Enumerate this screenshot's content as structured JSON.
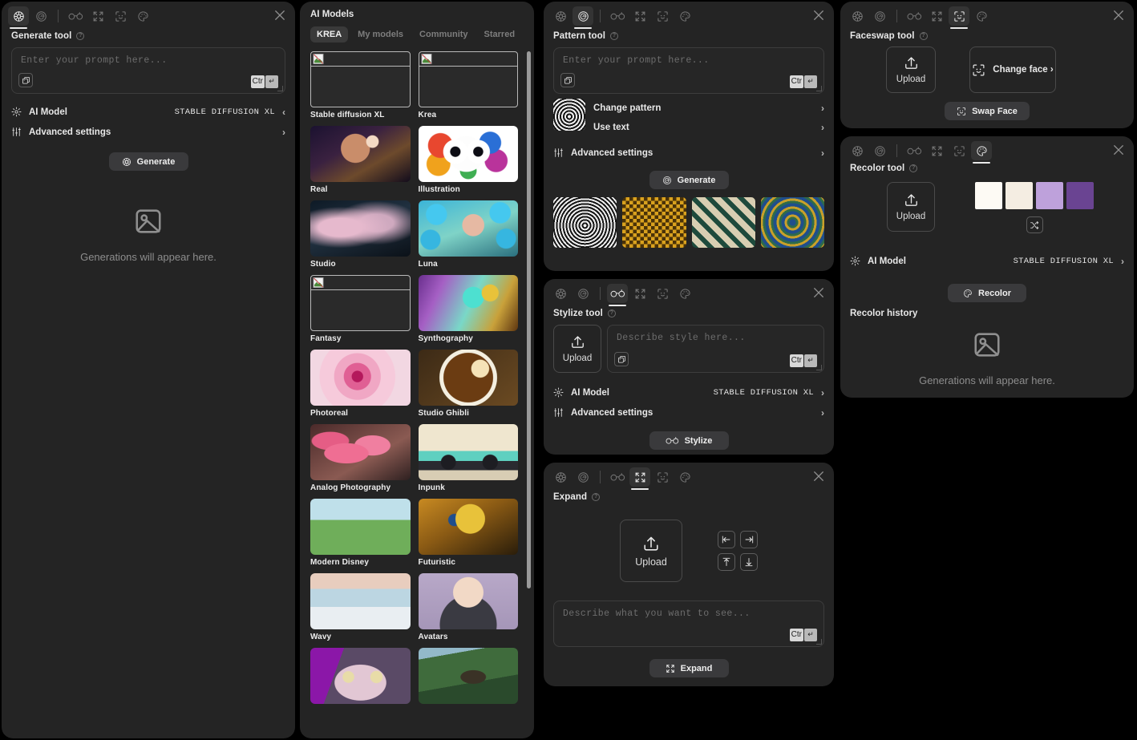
{
  "toolbar": {
    "tabs": [
      {
        "name": "generate",
        "icon": "aperture-icon"
      },
      {
        "name": "pattern",
        "icon": "spiral-icon"
      },
      {
        "name": "stylize",
        "icon": "glasses-icon"
      },
      {
        "name": "expand",
        "icon": "expand-arrows-icon"
      },
      {
        "name": "faceswap",
        "icon": "face-icon"
      },
      {
        "name": "recolor",
        "icon": "palette-icon"
      }
    ],
    "close_icon": "close-icon"
  },
  "kbd": {
    "ctrl": "Ctr",
    "enter": "↵"
  },
  "generate_panel": {
    "title": "Generate tool",
    "prompt_placeholder": "Enter your prompt here...",
    "ai_model_label": "AI Model",
    "ai_model_value": "STABLE DIFFUSION XL",
    "ai_model_chevron": "‹",
    "advanced_label": "Advanced settings",
    "advanced_chevron": "›",
    "button_label": "Generate",
    "empty_text": "Generations will appear here."
  },
  "models_panel": {
    "title": "AI Models",
    "tabs": [
      {
        "label": "KREA",
        "active": true
      },
      {
        "label": "My models",
        "active": false
      },
      {
        "label": "Community",
        "active": false
      },
      {
        "label": "Starred",
        "active": false
      }
    ],
    "models": [
      {
        "name": "Stable diffusion XL",
        "broken": true,
        "thumb": "none"
      },
      {
        "name": "Krea",
        "broken": true,
        "thumb": "none"
      },
      {
        "name": "Real",
        "broken": false,
        "thumb": "portrait-glitter"
      },
      {
        "name": "Illustration",
        "broken": false,
        "thumb": "colorful-skull"
      },
      {
        "name": "Studio",
        "broken": false,
        "thumb": "car-smoke"
      },
      {
        "name": "Luna",
        "broken": false,
        "thumb": "blue-flowers-woman"
      },
      {
        "name": "Fantasy",
        "broken": true,
        "thumb": "none"
      },
      {
        "name": "Synthography",
        "broken": false,
        "thumb": "iridescent-insect"
      },
      {
        "name": "Photoreal",
        "broken": false,
        "thumb": "pink-rose"
      },
      {
        "name": "Studio Ghibli",
        "broken": false,
        "thumb": "ramen-bowl"
      },
      {
        "name": "Analog Photography",
        "broken": false,
        "thumb": "pink-leaves"
      },
      {
        "name": "Inpunk",
        "broken": false,
        "thumb": "teal-sportscar"
      },
      {
        "name": "Modern Disney",
        "broken": false,
        "thumb": "pink-castle"
      },
      {
        "name": "Futuristic",
        "broken": false,
        "thumb": "gold-robot-head"
      },
      {
        "name": "Wavy",
        "broken": false,
        "thumb": "snow-cabin"
      },
      {
        "name": "Avatars",
        "broken": false,
        "thumb": "3d-avatar"
      },
      {
        "name": "",
        "broken": false,
        "thumb": "purple-hair-eyes"
      },
      {
        "name": "",
        "broken": false,
        "thumb": "green-pagoda"
      }
    ]
  },
  "pattern_panel": {
    "title": "Pattern tool",
    "prompt_placeholder": "Enter your prompt here...",
    "change_pattern_label": "Change pattern",
    "use_text_label": "Use text",
    "advanced_label": "Advanced settings",
    "chevron": "›",
    "button_label": "Generate",
    "thumbnails": [
      "heart-op-art",
      "gold-checkerboard",
      "green-diamond-tile",
      "blue-gold-spiral"
    ]
  },
  "stylize_panel": {
    "title": "Stylize tool",
    "upload_label": "Upload",
    "prompt_placeholder": "Describe style here...",
    "ai_model_label": "AI Model",
    "ai_model_value": "STABLE DIFFUSION XL",
    "advanced_label": "Advanced settings",
    "chevron": "›",
    "button_label": "Stylize"
  },
  "expand_panel": {
    "title": "Expand",
    "upload_label": "Upload",
    "prompt_placeholder": "Describe what you want to see...",
    "directions": [
      {
        "name": "expand-left",
        "icon": "arrow-left-to-bar-icon"
      },
      {
        "name": "expand-right",
        "icon": "arrow-right-to-bar-icon"
      },
      {
        "name": "expand-up",
        "icon": "arrow-up-from-bar-icon"
      },
      {
        "name": "expand-down",
        "icon": "arrow-down-to-bar-icon"
      }
    ],
    "button_label": "Expand"
  },
  "faceswap_panel": {
    "title": "Faceswap tool",
    "upload_label": "Upload",
    "change_face_label": "Change face ›",
    "button_label": "Swap Face"
  },
  "recolor_panel": {
    "title": "Recolor tool",
    "upload_label": "Upload",
    "swatches": [
      "#FDFAF4",
      "#F4EDE2",
      "#BEA1DB",
      "#6A4492"
    ],
    "shuffle_icon": "shuffle-icon",
    "ai_model_label": "AI Model",
    "ai_model_value": "STABLE DIFFUSION XL",
    "chevron": "›",
    "button_label": "Recolor",
    "history_label": "Recolor history",
    "empty_text": "Generations will appear here."
  }
}
